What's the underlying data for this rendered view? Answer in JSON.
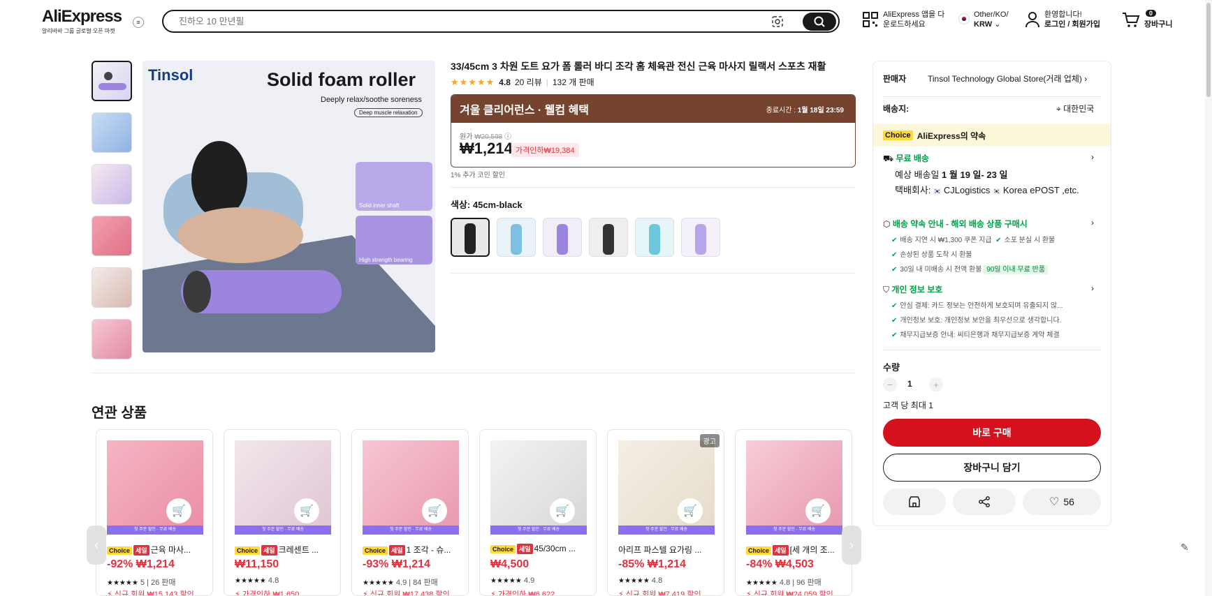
{
  "header": {
    "logo": "AliExpress",
    "logo_tagline": "알리바바 그룹 글로벌 오픈 마켓",
    "search_placeholder": "진하오 10 만년필",
    "app_line1": "AliExpress 앱을 다",
    "app_line2": "운로드하세요",
    "locale_line1": "Other/KO/",
    "locale_line2": "KRW",
    "account_line1": "환영합니다!",
    "account_line2": "로그인 / 회원가입",
    "cart_count": "0",
    "cart_label": "장바구니"
  },
  "gallery": {
    "main_title": "Solid foam roller",
    "main_sub": "Deeply relax/soothe soreness",
    "main_pill": "Deep muscle relaxation",
    "brand": "Tinsol",
    "inset1": "Solid inner shaft",
    "inset2": "High strength bearing"
  },
  "product": {
    "title": "33/45cm 3 차원 도트 요가 폼 롤러 바디 조각 홈 체육관 전신 근육 마사지 릴랙서 스포츠 재활",
    "rating": "4.8",
    "reviews": "20 리뷰",
    "sold": "132 개 판매",
    "promo_title": "겨울 클리어런스 · 웰컴 혜택",
    "promo_end_label": "종료시간 :",
    "promo_end": "1월 18일 23:59",
    "origin_label": "원가",
    "origin_price": "₩20,598",
    "price": "₩1,214",
    "discount": "가격인하₩19,384",
    "coin": "1% 추가 코인 할인",
    "color_label": "색상: 45cm-black"
  },
  "related": {
    "title": "연관 상품",
    "items": [
      {
        "name": "근육 마사...",
        "price": "-92% ₩1,214",
        "rating": "5",
        "sold": "26 판매",
        "sub": "신규 회원 ₩15,143 할인",
        "strip": "첫 주문 할인 · 무료 배송"
      },
      {
        "name": "크레센트 ...",
        "price": "₩11,150",
        "rating": "4.8",
        "sold": "",
        "sub": "가격인하 ₩1,650",
        "strip": "첫 주문 할인 · 무료 배송"
      },
      {
        "name": "1 조각 - 슈...",
        "price": "-93% ₩1,214",
        "rating": "4.9",
        "sold": "84 판매",
        "sub": "신규 회원 ₩17,438 할인",
        "strip": "첫 주문 할인 · 무료 배송"
      },
      {
        "name": "45/30cm ...",
        "price": "₩4,500",
        "rating": "4.9",
        "sold": "",
        "sub": "가격인하 ₩6,622",
        "strip": "첫 주문 할인 · 무료 배송"
      },
      {
        "name": "아리프 파스텔 요가링 ...",
        "price": "-85% ₩1,214",
        "rating": "4.8",
        "sold": "",
        "sub": "신규 회원 ₩7,419 할인",
        "strip": "첫 주문 할인 · 무료 배송",
        "ad": "광고"
      },
      {
        "name": "[세 개의 조...",
        "price": "-84% ₩4,503",
        "rating": "4.8",
        "sold": "96 판매",
        "sub": "신규 회원 ₩24,059 할인",
        "strip": "첫 주문 할인 · 무료 배송"
      }
    ]
  },
  "panel": {
    "seller_label": "판매자",
    "seller": "Tinsol Technology Global Store(거래 업체)",
    "ship_to_label": "배송지:",
    "ship_to": "대한민국",
    "choice_chip": "Choice",
    "choice_promise": "AliExpress의 약속",
    "free_ship": "무료 배송",
    "eta_label": "예상 배송일",
    "eta": "1 월 19 일- 23 일",
    "carrier_label": "택배회사:",
    "carrier": "CJLogistics",
    "carrier2": "Korea",
    "carrier3": "ePOST ,etc.",
    "promise_title": "배송 약속 안내 - 해외 배송 상품 구매시",
    "promise1": "배송 지연 시 ₩1,300 쿠폰 지급",
    "promise2": "소포 분실 시 환불",
    "promise3": "손상된 상품 도착 시 환불",
    "promise4": "30일 내 미배송 시 전액 환불",
    "promise_badge": "90일 이내 무료 반품",
    "privacy_title": "개인 정보 보호",
    "privacy1": "안심 결제: 카드 정보는 안전하게 보호되며 유출되지 않...",
    "privacy2": "개인정보 보호: 개인정보 보안을 최우선으로 생각합니다.",
    "privacy3": "채무지급보증 안내: 씨티은행과 채무지급보증 계약 체결",
    "qty_label": "수량",
    "qty": "1",
    "limit": "고객 당 최대 1",
    "buy_now": "바로 구매",
    "add_cart": "장바구니 담기",
    "wish_count": "56"
  },
  "colors": {
    "accent": "#d5111e",
    "promo": "#75432e",
    "choice": "#ffd93a",
    "green": "#00a048"
  }
}
